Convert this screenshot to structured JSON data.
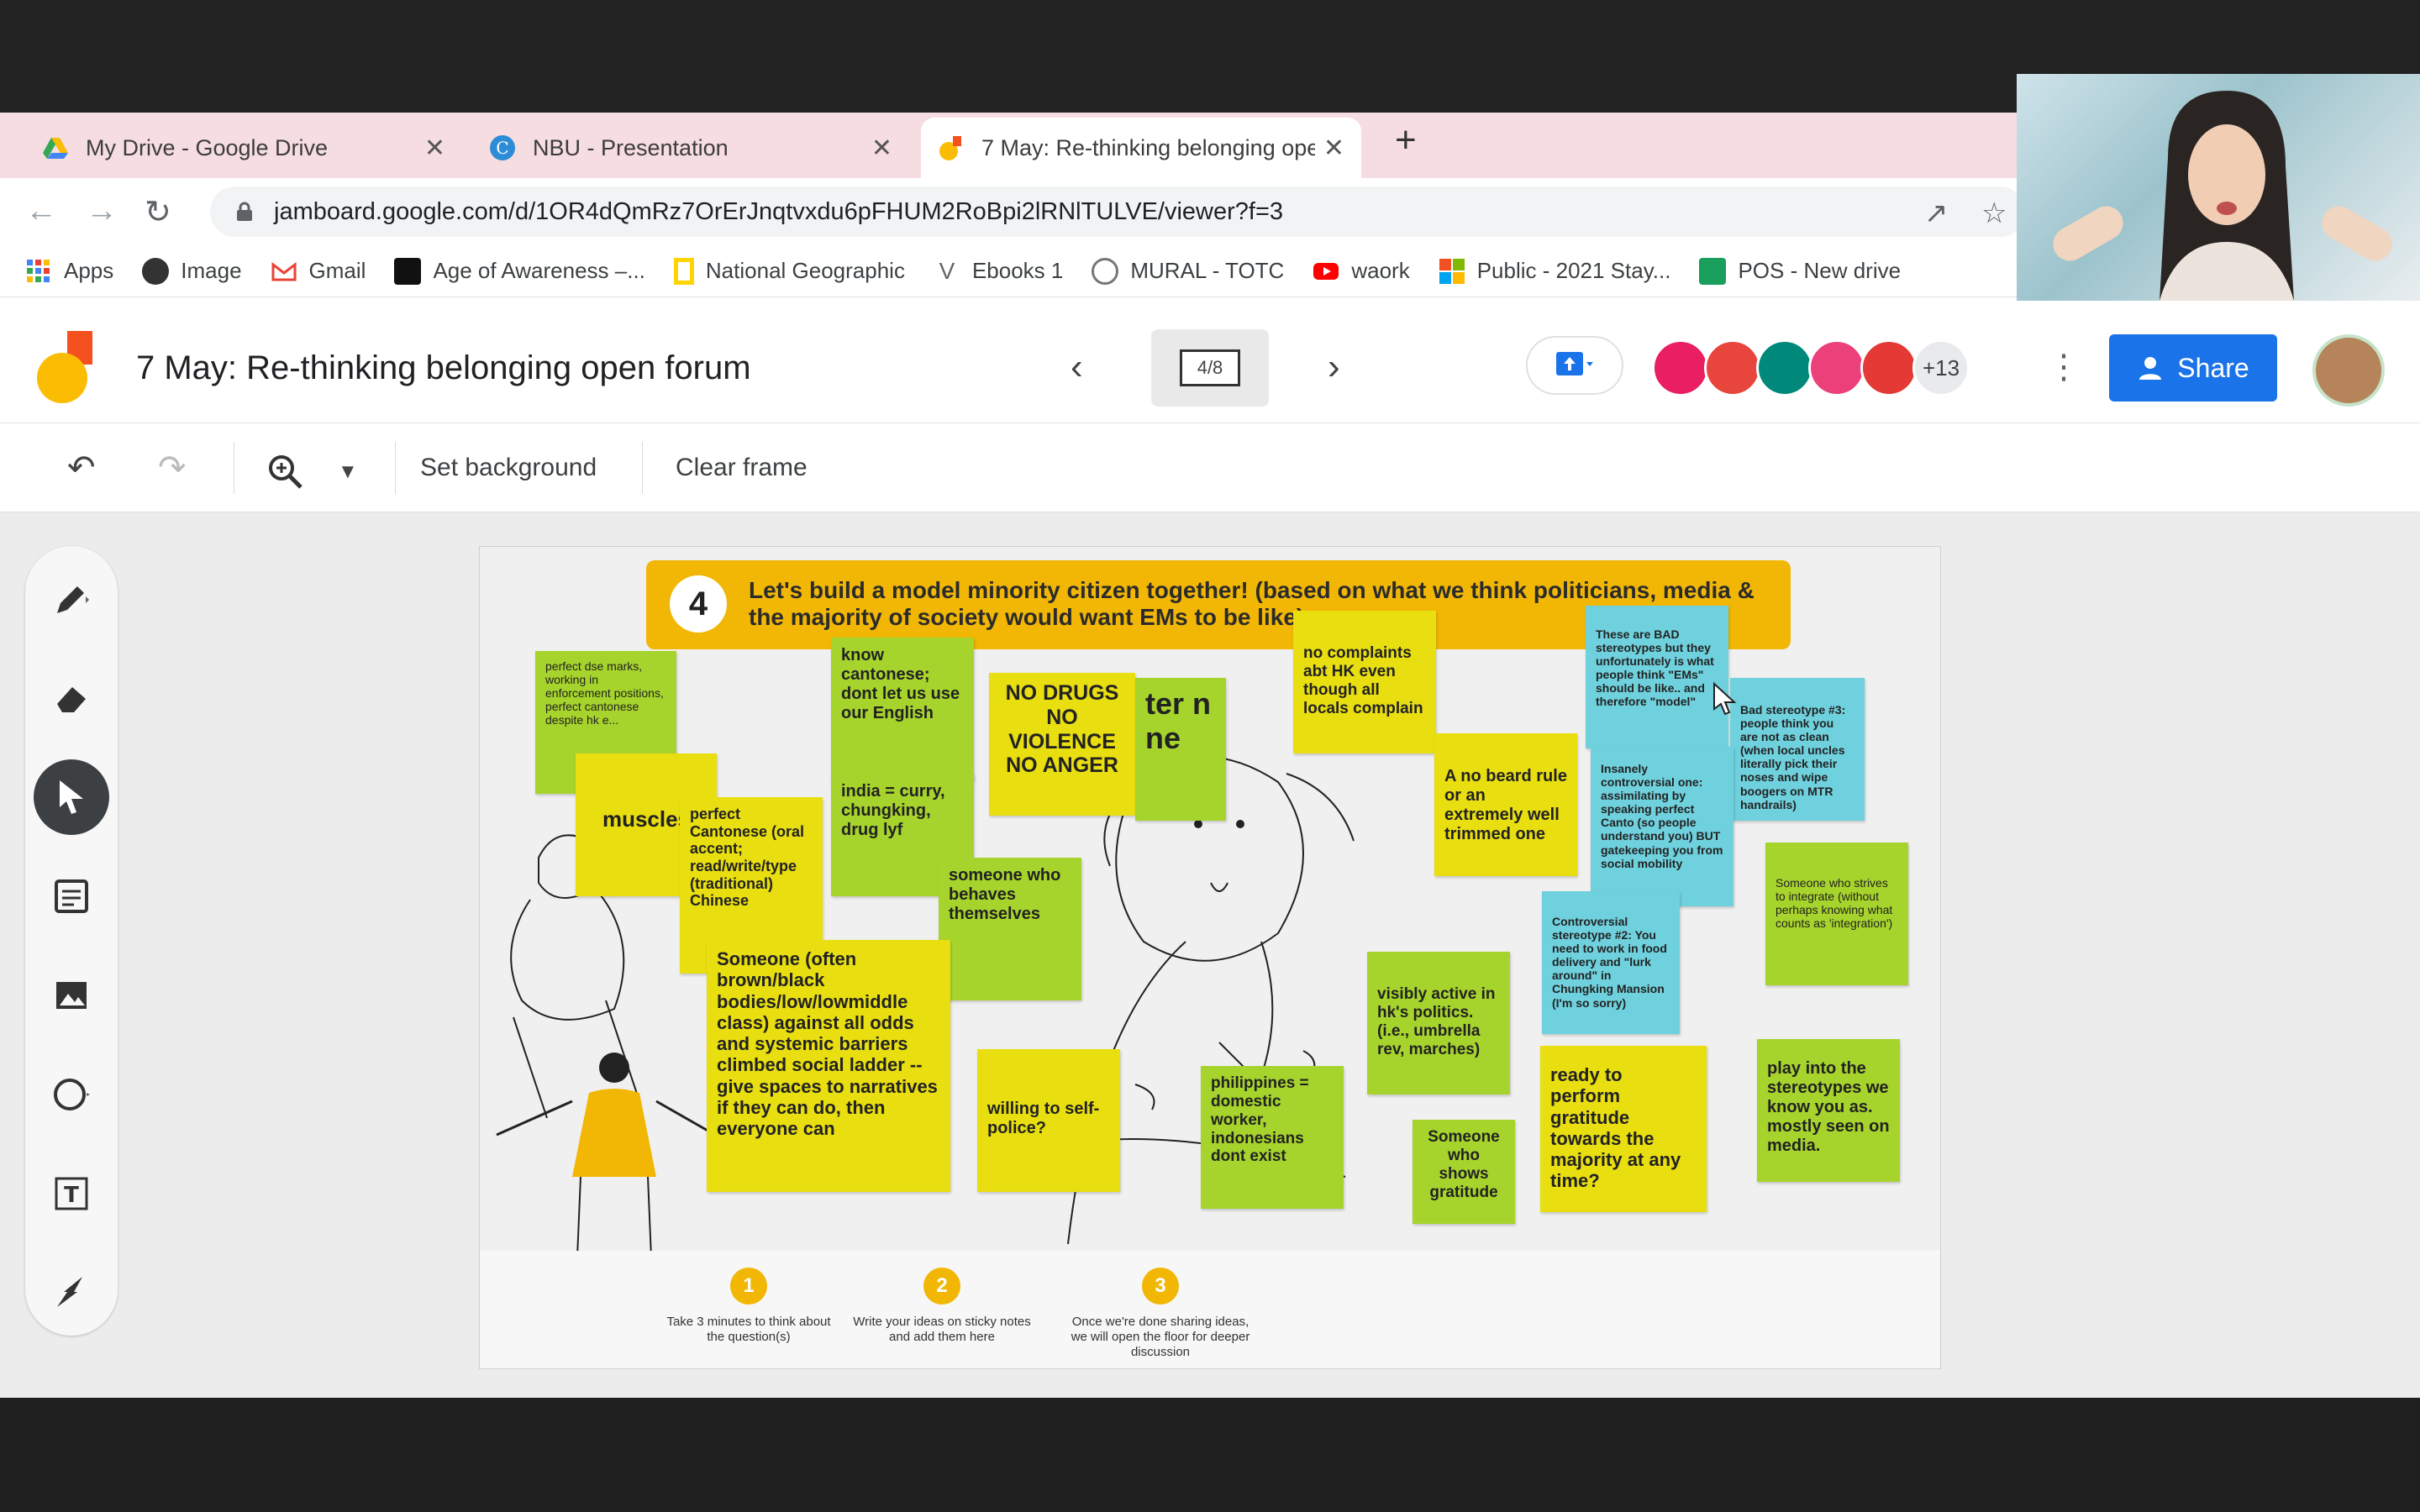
{
  "browser": {
    "tabs": [
      {
        "label": "My Drive - Google Drive",
        "active": false
      },
      {
        "label": "NBU - Presentation",
        "active": false
      },
      {
        "label": "7 May: Re-thinking belonging open forum",
        "active": true
      }
    ],
    "close_glyph": "✕",
    "new_tab_glyph": "+",
    "url": "jamboard.google.com/d/1OR4dQmRz7OrErJnqtvxdu6pFHUM2RoBpi2lRNlTULVE/viewer?f=3",
    "bookmarks": [
      {
        "label": "Apps",
        "color": "#4285f4"
      },
      {
        "label": "Image",
        "color": "#333333"
      },
      {
        "label": "Gmail",
        "color": "#ea4335"
      },
      {
        "label": "Age of Awareness –...",
        "color": "#111111"
      },
      {
        "label": "National Geographic",
        "color": "#ffd400"
      },
      {
        "label": "Ebooks 1",
        "color": "#666666"
      },
      {
        "label": "MURAL - TOTC",
        "color": "#777777"
      },
      {
        "label": "waork",
        "color": "#ff0000"
      },
      {
        "label": "Public - 2021 Stay...",
        "color": "#f25022"
      },
      {
        "label": "POS - New drive",
        "color": "#1a9e5c"
      }
    ]
  },
  "jamboard": {
    "title": "7 May: Re-thinking belonging open forum",
    "frame_indicator": "4/8",
    "more_collaborators": "+13",
    "share_label": "Share",
    "toolbar": {
      "set_background": "Set background",
      "clear_frame": "Clear frame"
    },
    "colors": {
      "share_blue": "#1a73e8",
      "sticky_lime": "#a6d42c",
      "sticky_yellow": "#e9de10",
      "sticky_cyan": "#6fd1dd",
      "banner": "#f2b705"
    }
  },
  "board": {
    "banner_number": "4",
    "banner_text": "Let's build a model minority citizen together! (based on what we think politicians, media & the majority of society would want EMs to be like)",
    "notes": {
      "n1": "perfect dse marks, working in enforcement positions, perfect cantonese despite hk e...",
      "n2": "muscles",
      "n3": "know cantonese; dont let us use our English",
      "n4": "india = curry, chungking, drug lyf",
      "n5": "NO DRUGS NO VIOLENCE NO ANGER",
      "n6": "ter n ne",
      "n7": "perfect Cantonese (oral accent; read/write/type (traditional) Chinese",
      "n8": "someone who behaves themselves",
      "n9": "Someone (often brown/black bodies/low/lowmiddle class) against all odds and systemic barriers climbed social ladder -- give spaces to narratives if they can do, then everyone can",
      "n10": "willing to self-police?",
      "n11": "no complaints abt HK even though all locals complain",
      "n12": "A no beard rule or an extremely well trimmed one",
      "n13": "visibly active in hk's politics. (i.e., umbrella rev, marches)",
      "n14": "philippines = domestic worker, indonesians dont exist",
      "n15": "Someone who shows gratitude",
      "n16": "ready to perform gratitude towards the majority at any time?",
      "n17": "These are BAD stereotypes but they unfortunately is what people think \"EMs\" should be like.. and therefore \"model\"",
      "n18": "Bad stereotype #3: people think you are not as clean (when local uncles literally pick their noses and wipe boogers on MTR handrails)",
      "n19": "Insanely controversial one: assimilating by speaking perfect Canto (so people understand you) BUT gatekeeping you from social mobility",
      "n20": "Controversial stereotype #2: You need to work in food delivery and \"lurk around\" in Chungking Mansion (I'm so sorry)",
      "n21": "Someone who strives to integrate (without perhaps knowing what counts as 'integration')",
      "n22": "play into the stereotypes we know you as. mostly seen on media."
    },
    "steps": [
      {
        "num": "1",
        "text": "Take 3 minutes to think about the question(s)"
      },
      {
        "num": "2",
        "text": "Write your ideas on sticky notes and add them here"
      },
      {
        "num": "3",
        "text": "Once we're done sharing ideas, we will open the floor for deeper discussion"
      }
    ]
  }
}
